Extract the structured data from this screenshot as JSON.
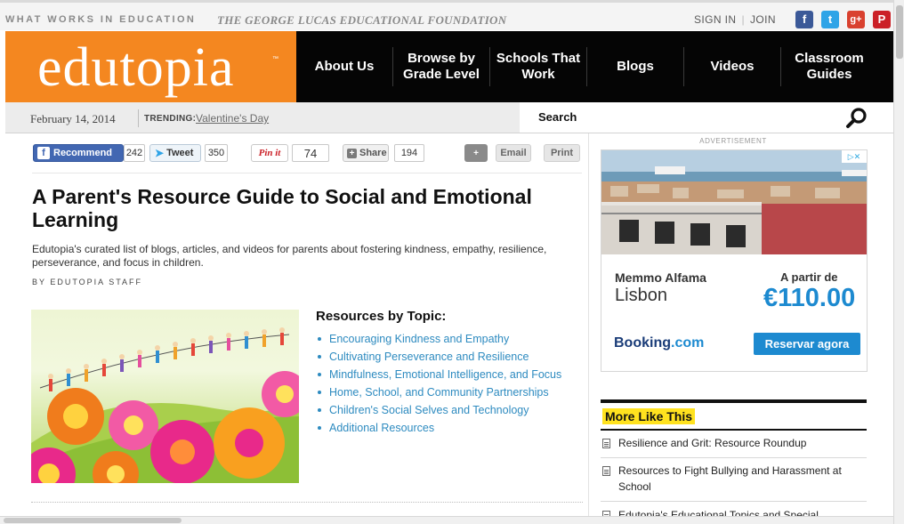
{
  "header": {
    "tagline": "WHAT WORKS IN EDUCATION",
    "foundation": "THE GEORGE LUCAS EDUCATIONAL FOUNDATION",
    "sign_in": "SIGN IN",
    "join": "JOIN",
    "social": [
      {
        "name": "facebook",
        "glyph": "f",
        "color": "#3b5998"
      },
      {
        "name": "twitter",
        "glyph": "t",
        "color": "#2fa4e7"
      },
      {
        "name": "google-plus",
        "glyph": "g+",
        "color": "#d9412f"
      },
      {
        "name": "pinterest",
        "glyph": "P",
        "color": "#cb2027"
      }
    ],
    "logo": "edutopia",
    "logo_tm": "™",
    "logo_color": "#f48720"
  },
  "nav": {
    "items": [
      {
        "label": "About Us"
      },
      {
        "label": "Browse by Grade Level"
      },
      {
        "label": "Schools That Work"
      },
      {
        "label": "Blogs"
      },
      {
        "label": "Videos"
      },
      {
        "label": "Classroom Guides"
      }
    ]
  },
  "datebar": {
    "date": "February 14, 2014",
    "trending_label": "TRENDING:",
    "trending_link": "Valentine's Day"
  },
  "search": {
    "label": "Search",
    "placeholder": ""
  },
  "share": {
    "recommend_label": "Recommend",
    "recommend_count": "242",
    "tweet_label": "Tweet",
    "tweet_count": "350",
    "pinit_label": "Pin it",
    "pinit_count": "74",
    "share_label": "Share",
    "share_count": "194",
    "comment_glyph": "+",
    "email_label": "Email",
    "print_label": "Print"
  },
  "article": {
    "title": "A Parent's Resource Guide to Social and Emotional Learning",
    "dek": "Edutopia's curated list of blogs, articles, and videos for parents about fostering kindness, empathy, resilience, perseverance, and focus in children.",
    "byline": "BY EDUTOPIA STAFF",
    "topics_heading": "Resources by Topic:",
    "topics": [
      "Encouraging Kindness and Empathy",
      "Cultivating Perseverance and Resilience",
      "Mindfulness, Emotional Intelligence, and Focus",
      "Home, School, and Community Partnerships",
      "Children's Social Selves and Technology",
      "Additional Resources"
    ],
    "link_color": "#2e8bc0"
  },
  "sidebar": {
    "ad_label": "ADVERTISEMENT",
    "ad": {
      "choices_glyph": "▷✕",
      "hotel": "Memmo Alfama",
      "city": "Lisbon",
      "from": "A partir de",
      "price": "€110.00",
      "brand_a": "Booking",
      "brand_b": ".com",
      "cta": "Reservar agora"
    },
    "more_heading": "More Like This",
    "more_items": [
      {
        "title": "Resilience and Grit: Resource Roundup"
      },
      {
        "title": "Resources to Fight Bullying and Harassment at School"
      },
      {
        "title": "Edutopia's Educational Topics and Special"
      }
    ]
  }
}
